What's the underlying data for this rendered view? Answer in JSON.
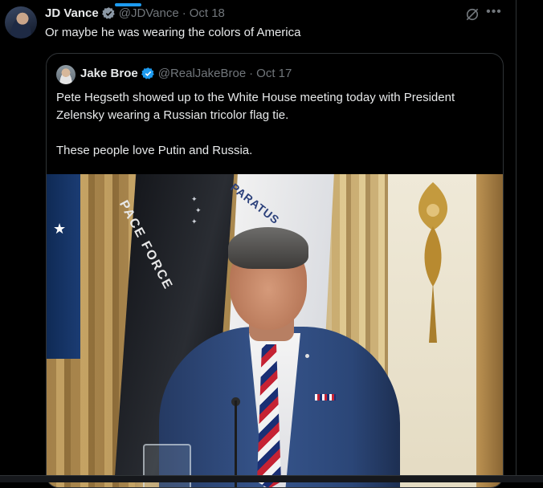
{
  "tweet": {
    "author_name": "JD Vance",
    "author_handle": "@JDVance",
    "separator": "·",
    "timestamp": "Oct 18",
    "text": "Or maybe he was wearing the colors of America"
  },
  "quoted_tweet": {
    "author_name": "Jake Broe",
    "author_handle": "@RealJakeBroe",
    "separator": "·",
    "timestamp": "Oct 17",
    "text_line1": "Pete Hegseth showed up to the White House meeting today with President Zelensky wearing a Russian tricolor flag tie.",
    "text_line2": "These people love Putin and Russia.",
    "photo": {
      "flag_text_black": "PACE FORCE",
      "flag_text_white": "PARATUS"
    }
  },
  "icons": {
    "verified": "verified-badge-icon",
    "grok": "grok-icon",
    "more": "more-icon"
  },
  "colors": {
    "accent": "#1d9bf0",
    "background": "#000000",
    "text_primary": "#e7e9ea",
    "text_secondary": "#71767b",
    "border": "#2f3336"
  }
}
